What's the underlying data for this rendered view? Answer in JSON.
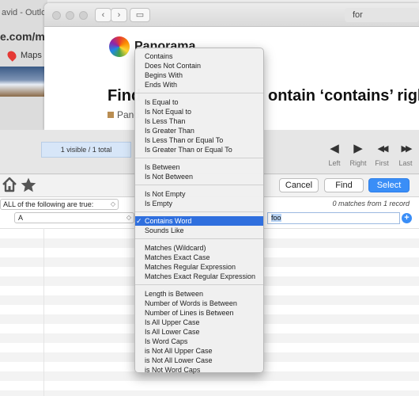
{
  "background_browser": {
    "tab_title": "avid - Outlo",
    "url_fragment": "e.com/mail/",
    "bookmark_label": "Maps"
  },
  "safari": {
    "address": "for",
    "brand": "Panorama",
    "headline_left": "Find",
    "headline_right": "ontain ‘contains’ right",
    "category": "Pano"
  },
  "toolbar": {
    "visible_count": "1 visible / 1 total",
    "nav": [
      {
        "label": "Left",
        "glyph": "◀"
      },
      {
        "label": "Right",
        "glyph": "▶"
      },
      {
        "label": "First",
        "glyph": "◀◀"
      },
      {
        "label": "Last",
        "glyph": "▶▶"
      }
    ]
  },
  "find": {
    "cancel_label": "Cancel",
    "find_label": "Find",
    "select_label": "Select",
    "match_mode": "ALL of the following are true:",
    "match_count": "0 matches from 1 record",
    "field": "A",
    "value": "foo"
  },
  "menu": {
    "groups": [
      [
        "Contains",
        "Does Not Contain",
        "Begins With",
        "Ends With"
      ],
      [
        "Is Equal to",
        "Is Not Equal to",
        "Is Less Than",
        "Is Greater Than",
        "Is Less Than or Equal To",
        "Is Greater Than or Equal To"
      ],
      [
        "Is Between",
        "Is Not Between"
      ],
      [
        "Is Not Empty",
        "Is Empty"
      ],
      [
        "Contains Word",
        "Sounds Like"
      ],
      [
        "Matches (Wildcard)",
        "Matches Exact Case",
        "Matches Regular Expression",
        "Matches Exact Regular Expression"
      ],
      [
        "Length is Between",
        "Number of Words is Between",
        "Number of Lines is Between",
        "Is All Upper Case",
        "Is All Lower Case",
        "Is Word Caps",
        "is Not All Upper Case",
        "is Not All Lower Case",
        "is Not Word Caps"
      ]
    ],
    "selected": "Contains Word",
    "check_mark": "✓"
  }
}
